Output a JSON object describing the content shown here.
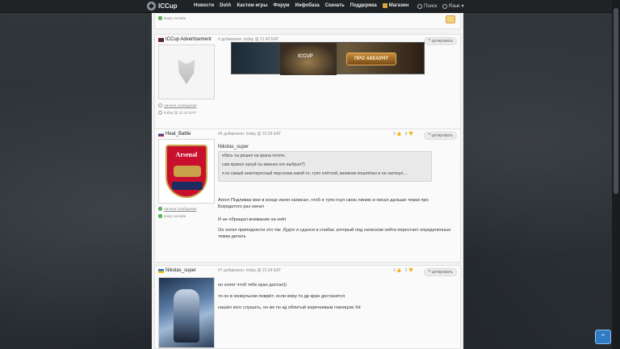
{
  "nav": {
    "logo": "ICCup",
    "items": [
      "Новости",
      "DotA",
      "Кастом игры",
      "Форум",
      "Инфобаза",
      "Скачать",
      "Поддержка",
      "Магазин"
    ],
    "search": "Поиск",
    "language": "Язык"
  },
  "top_fragment": {
    "status": "юзер онлайн"
  },
  "posts": [
    {
      "author": "ICCup Advertisement",
      "meta": "# добавлено: today @ 21:42 EAT",
      "quote_btn": "цитировать",
      "banner_button": "ПРО АККАУНТ",
      "banner_logo": "ICCUP",
      "side_links": [
        "личное сообщение",
        "today @ 21:42 EAT"
      ]
    },
    {
      "author": "Heat_Battle",
      "meta": "#6 добавлено: today @ 21:29 EAT",
      "quote_btn": "цитировать",
      "votes": [
        "0",
        "0"
      ],
      "avatar_text": "Arsenal",
      "side_links": [
        "личное сообщение",
        "юзер онлайн"
      ],
      "quoted_user": "Nikolas_super",
      "quote_lines": [
        "ебать ты решил на крана потеть",
        "сам прикол нахуй ты именно его выбрал?)",
        "я хз самый неинтересный персонаж какой то, тупо плётхой, веником пошлёпал и не натянул...."
      ],
      "body": [
        "Агент Подливка мне в конце июля написал ,чтоб я тупо гнул свою линию и писал дальше темки про Бородатого раз начал",
        "И не обращал внимание на хейт",
        "Он хотел приподнести это так ,будто я сдался и слабак ,который под натиском хейта перестает определенные темки делать"
      ]
    },
    {
      "author": "Nikolas_super",
      "meta": "#7 добавлено: today @ 21:34 EAT",
      "quote_btn": "цитировать",
      "votes": [
        "0",
        "0"
      ],
      "body": [
        "он хочет чтоб тебе кран достал))",
        "то он в конвульсии помрёт, если кому то др кран достанется",
        "нашёл кого слушать, он же по кд облитый коричневым говняцом Xd"
      ]
    }
  ]
}
